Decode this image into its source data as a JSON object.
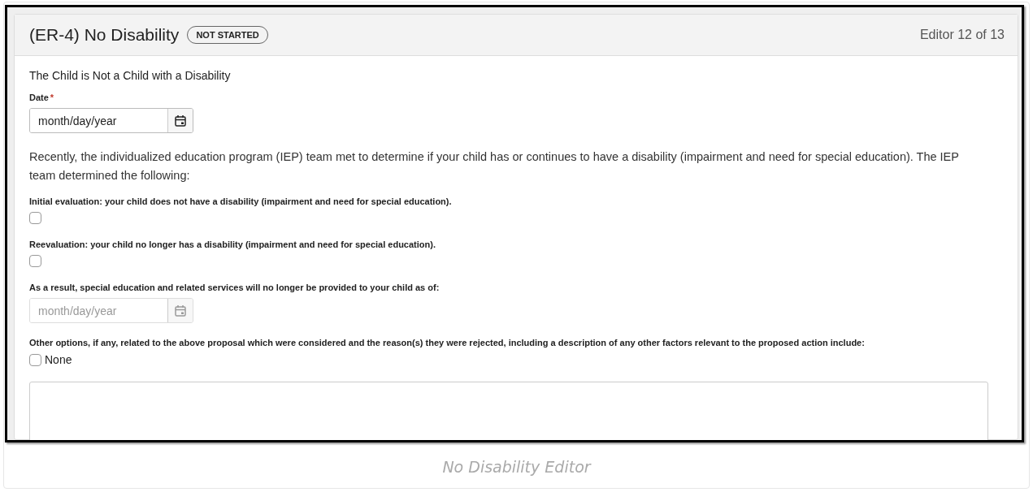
{
  "editor": {
    "title": "(ER-4) No Disability",
    "status": "NOT STARTED",
    "position": "Editor 12 of 13"
  },
  "fields": [
    {
      "kind": "heading",
      "text": "The Child is Not a Child with a Disability"
    },
    {
      "kind": "date",
      "label": "Date",
      "required_mark": "*",
      "placeholder": "month/day/year",
      "disabled": false
    },
    {
      "kind": "paragraph",
      "text": "Recently, the individualized education program (IEP) team met to determine if your child has or continues to have a disability (impairment and need for special education). The IEP team determined the following:"
    },
    {
      "kind": "checkbox",
      "label": "Initial evaluation: your child does not have a disability (impairment and need for special education).",
      "checked": false
    },
    {
      "kind": "checkbox",
      "label": "Reevaluation: your child no longer has a disability (impairment and need for special education).",
      "checked": false
    },
    {
      "kind": "date",
      "label": "As a result, special education and related services will no longer be provided to your child as of:",
      "placeholder": "month/day/year",
      "disabled": true
    },
    {
      "kind": "inline-checkbox",
      "label": "Other options, if any, related to the above proposal which were considered and the reason(s) they were rejected, including a description of any other factors relevant to the proposed action include:",
      "option": "None",
      "checked": false
    },
    {
      "kind": "textarea"
    }
  ],
  "caption": "No Disability Editor"
}
